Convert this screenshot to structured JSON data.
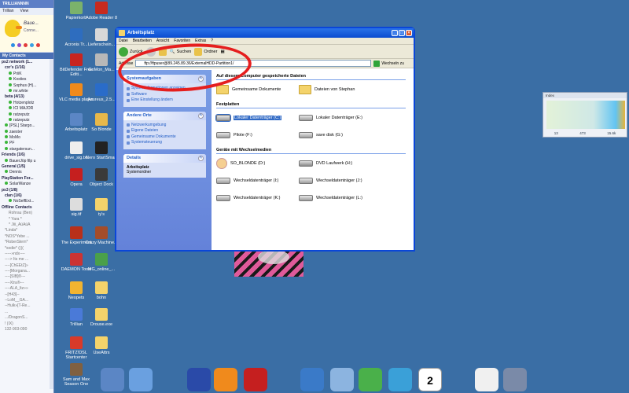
{
  "trillian": {
    "title": "TRILLIANNNN",
    "menu": [
      "Trillian",
      "View"
    ],
    "profile_name": "Baue...",
    "profile_status": "Conne...",
    "status_dot_colors": [
      "#2a8de3",
      "#8c4dcc",
      "#e23a3a",
      "#3aa0e3",
      "#e23a3a"
    ],
    "contacts_header": "My Contacts",
    "contacts": [
      {
        "text": "ps2 network (1...",
        "kind": "grp"
      },
      {
        "text": "cxr's (1/16)",
        "kind": "sub grp"
      },
      {
        "text": "PriiK",
        "kind": "l2"
      },
      {
        "text": "Kosties",
        "kind": "l2"
      },
      {
        "text": "Sophus (H)...",
        "kind": "l2"
      },
      {
        "text": "mr.white",
        "kind": "l2"
      },
      {
        "text": "beta (4/13)",
        "kind": "sub grp"
      },
      {
        "text": "Hotzenplotz",
        "kind": "l2"
      },
      {
        "text": "ICI MAJOR",
        "kind": "l2"
      },
      {
        "text": "ratzeputz",
        "kind": "l2"
      },
      {
        "text": "ratzeputz",
        "kind": "l2"
      },
      {
        "text": "[PSL] Stargo...",
        "kind": "sub"
      },
      {
        "text": "zaester",
        "kind": "sub"
      },
      {
        "text": "MoMo",
        "kind": "sub"
      },
      {
        "text": "PF",
        "kind": "sub"
      },
      {
        "text": "stargatersun...",
        "kind": "sub"
      },
      {
        "text": "Friends (1/6)",
        "kind": "grp"
      },
      {
        "text": "BauerJöp filp u",
        "kind": "sub"
      },
      {
        "text": "General (1/5)",
        "kind": "grp"
      },
      {
        "text": "Dennis",
        "kind": "sub"
      },
      {
        "text": "PlayStation For...",
        "kind": "grp"
      },
      {
        "text": "SolarWanze",
        "kind": "sub"
      },
      {
        "text": "ps3 (1/8)",
        "kind": "grp"
      },
      {
        "text": "clan (1/6)",
        "kind": "sub grp"
      },
      {
        "text": "NoSelfExt...",
        "kind": "l2"
      },
      {
        "text": "Offline Contacts",
        "kind": "grp"
      },
      {
        "text": "Rohrau (Ben)",
        "kind": "l2 off"
      },
      {
        "text": "* Yara *",
        "kind": "l2 off"
      },
      {
        "text": "* Jiii_ÄüÄüÄ",
        "kind": "l2 off"
      },
      {
        "text": "*Linda*",
        "kind": "sub off"
      },
      {
        "text": "*NOS*Yebe ...",
        "kind": "sub off"
      },
      {
        "text": "*RoberStern*",
        "kind": "sub off"
      },
      {
        "text": "*sodie* ((((",
        "kind": "sub off"
      },
      {
        "text": "-----»ndx----",
        "kind": "sub off"
      },
      {
        "text": "----> Its me ...",
        "kind": "sub off"
      },
      {
        "text": "----[ChEEtZ]»",
        "kind": "sub off"
      },
      {
        "text": "----[Morgana...",
        "kind": "sub off"
      },
      {
        "text": "----[SIB]®---",
        "kind": "sub off"
      },
      {
        "text": "----Xtra®---",
        "kind": "sub off"
      },
      {
        "text": "----ÄLÄ_Itz»»",
        "kind": "sub off"
      },
      {
        "text": "--[H43]--",
        "kind": "sub off"
      },
      {
        "text": "--LoM__GA...",
        "kind": "sub off"
      },
      {
        "text": "--Hulk»[T-Re...",
        "kind": "sub off"
      },
      {
        "text": "...",
        "kind": "sub off"
      },
      {
        "text": ".../DragonS...",
        "kind": "sub off"
      },
      {
        "text": "! (IX)",
        "kind": "sub off"
      },
      {
        "text": "132-903-090",
        "kind": "sub off"
      }
    ]
  },
  "desktop_icons": [
    {
      "label": "Papierkorb",
      "color": "#7bb26b"
    },
    {
      "label": "Adobe Reader 8",
      "color": "#c72a1f"
    },
    {
      "label": "Acronis Tr...",
      "color": "#2e6dbf"
    },
    {
      "label": "Lieferschein...",
      "color": "#d8d8d8"
    },
    {
      "label": "BitDefender Free Editi...",
      "color": "#c8241f"
    },
    {
      "label": "GoMon_Ma...",
      "color": "#b8b8b8"
    },
    {
      "label": "VLC media player",
      "color": "#f08a1c"
    },
    {
      "label": "Azureus_2.5...",
      "color": "#2a6cc9"
    },
    {
      "label": "Arbeitsplatz",
      "color": "#5b86c5"
    },
    {
      "label": "So Blonde",
      "color": "#e7b84a"
    },
    {
      "label": "drive_sig.txt",
      "color": "#eeeeee"
    },
    {
      "label": "Nero StartSmart",
      "color": "#222222"
    },
    {
      "label": "Opera",
      "color": "#c51f1f"
    },
    {
      "label": "Object Dock",
      "color": "#3a3a3a"
    },
    {
      "label": "sig.tif",
      "color": "#dddddd"
    },
    {
      "label": "ty's",
      "color": "#f4d36b"
    },
    {
      "label": "The Experiment",
      "color": "#b8301a"
    },
    {
      "label": "Crazy Machine...",
      "color": "#a44d2a"
    },
    {
      "label": "DAEMON Tools",
      "color": "#cc3333"
    },
    {
      "label": "MG_online_...",
      "color": "#4aa04a"
    },
    {
      "label": "Neopets",
      "color": "#f2b430"
    },
    {
      "label": "bohn",
      "color": "#f4d36b"
    },
    {
      "label": "Trillian",
      "color": "#4a7ad8"
    },
    {
      "label": "Drouse.exe",
      "color": "#f4d36b"
    },
    {
      "label": "FRITZ!DSL Startcenter",
      "color": "#d83a2a"
    },
    {
      "label": "UseAttrs",
      "color": "#f4d36b"
    },
    {
      "label": "Sam and Max Season One",
      "color": "#806040"
    }
  ],
  "window": {
    "title": "Arbeitsplatz",
    "menu": [
      "Datei",
      "Bearbeiten",
      "Ansicht",
      "Favoriten",
      "Extras",
      "?"
    ],
    "toolbar": {
      "back": "Zurück",
      "search": "Suchen",
      "folders": "Ordner"
    },
    "address_label": "Adresse",
    "address_value": "ftp://ftpuser@89.245.89.36/ExternalHDD-Partition1/",
    "go_label": "Wechseln zu",
    "tasks": [
      {
        "title": "Systemaufgaben",
        "links": [
          "Systeminformationen anzeigen",
          "Software",
          "Eine Einstellung ändern"
        ]
      },
      {
        "title": "Andere Orte",
        "links": [
          "Netzwerkumgebung",
          "Eigene Dateien",
          "Gemeinsame Dokumente",
          "Systemsteuerung"
        ]
      }
    ],
    "details": {
      "title": "Details",
      "name": "Arbeitsplatz",
      "sub": "Systemordner"
    },
    "sections": [
      {
        "title": "Auf diesem Computer gespeicherte Dateien",
        "items": [
          {
            "label": "Gemeinsame Dokumente",
            "icon": "folder"
          },
          {
            "label": "Dateien von Stephan",
            "icon": "folder"
          }
        ]
      },
      {
        "title": "Festplatten",
        "items": [
          {
            "label": "Lokaler Datenträger (C:)",
            "icon": "drive",
            "selected": true
          },
          {
            "label": "Lokaler Datenträger (E:)",
            "icon": "drive"
          },
          {
            "label": "Pilote (F:)",
            "icon": "drive"
          },
          {
            "label": "save disk (G:)",
            "icon": "drive"
          }
        ]
      },
      {
        "title": "Geräte mit Wechselmedien",
        "items": [
          {
            "label": "SO_BLONDE (D:)",
            "icon": "face"
          },
          {
            "label": "DVD Laufwerk (H:)",
            "icon": "dvd"
          },
          {
            "label": "Wechseldatenträger (I:)",
            "icon": "drive"
          },
          {
            "label": "Wechseldatenträger (J:)",
            "icon": "drive"
          },
          {
            "label": "Wechseldatenträger (K:)",
            "icon": "drive"
          },
          {
            "label": "Wechseldatenträger (L:)",
            "icon": "drive"
          }
        ]
      }
    ]
  },
  "widget": {
    "title": "Index",
    "readouts": [
      "13",
      "473",
      "15.6k"
    ]
  },
  "dock_icons": [
    {
      "name": "computer-icon",
      "color": "#5b86c5"
    },
    {
      "name": "window-icon",
      "color": "#6aa0e0"
    },
    {
      "name": "telescope-icon",
      "color": "#2a4aa8"
    },
    {
      "name": "vlc-icon",
      "color": "#f08a1c"
    },
    {
      "name": "opera-icon",
      "color": "#c51f1f"
    },
    {
      "name": "gear-icon",
      "color": "#3a7ac8"
    },
    {
      "name": "magnifier-icon",
      "color": "#8cb4e0"
    },
    {
      "name": "frog-icon",
      "color": "#4ab04a"
    },
    {
      "name": "recycle-icon",
      "color": "#3aa0d8"
    },
    {
      "name": "calendar-icon",
      "color": "#ffffff"
    },
    {
      "name": "note-icon",
      "color": "#f0f0f0"
    },
    {
      "name": "chair-icon",
      "color": "#7a8aa8"
    }
  ],
  "calendar_day": "2"
}
